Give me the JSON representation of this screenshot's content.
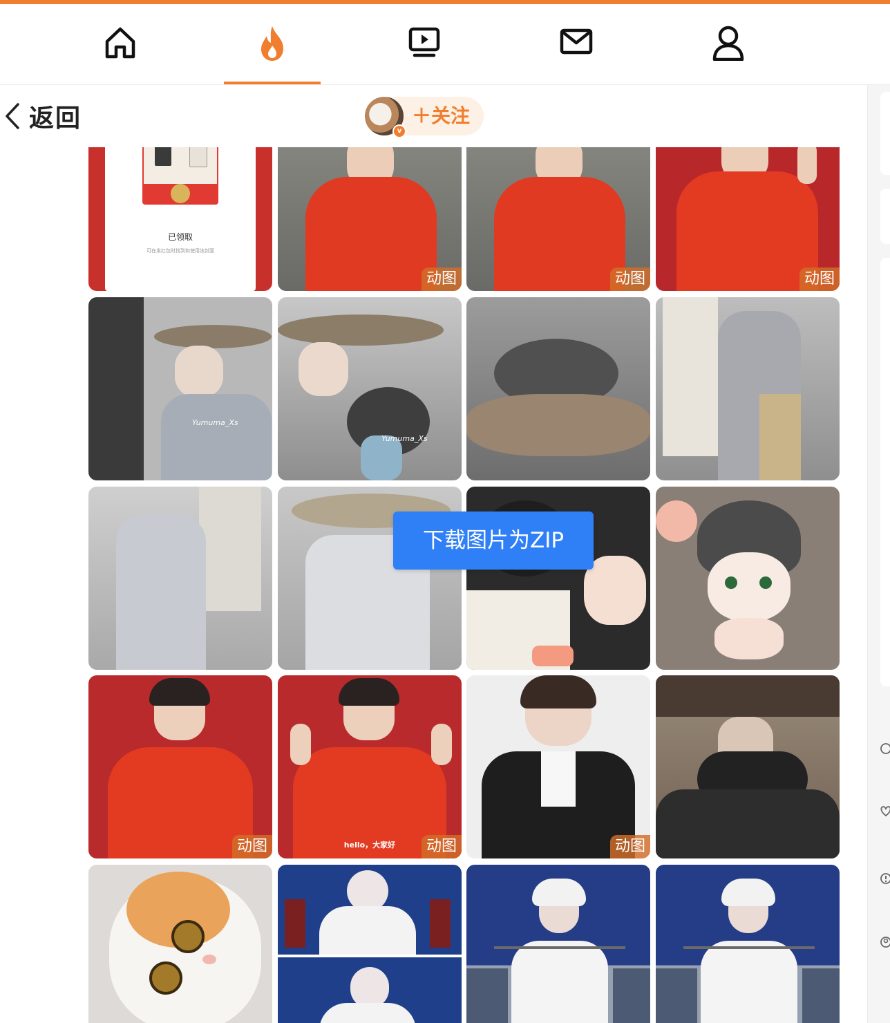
{
  "topnav": {
    "items": [
      {
        "icon": "home-icon",
        "active": false
      },
      {
        "icon": "fire-icon",
        "active": true
      },
      {
        "icon": "video-icon",
        "active": false
      },
      {
        "icon": "mail-icon",
        "active": false
      },
      {
        "icon": "user-icon",
        "active": false
      }
    ],
    "accent_color": "#f07e2e"
  },
  "header": {
    "back_label": "返回",
    "follow_label": "＋关注",
    "verified_badge": "v"
  },
  "gallery": {
    "gif_badge": "动图",
    "tiles": [
      {
        "id": "r0c0",
        "type": "red-envelope",
        "texts": [
          "已领取",
          "可在发红包时找到和使用该封面"
        ]
      },
      {
        "id": "r0c1",
        "type": "red-hoodie",
        "gif": true
      },
      {
        "id": "r0c2",
        "type": "red-hoodie",
        "gif": true
      },
      {
        "id": "r0c3",
        "type": "red-hoodie-wave",
        "gif": true
      },
      {
        "id": "r1c0",
        "type": "straw-hat",
        "watermark": "Yumuma_Xs"
      },
      {
        "id": "r1c1",
        "type": "straw-hat-crew",
        "watermark": "Yumuma_Xs"
      },
      {
        "id": "r1c2",
        "type": "straw-hat-closeup"
      },
      {
        "id": "r1c3",
        "type": "banner-scene"
      },
      {
        "id": "r2c0",
        "type": "banner-scene-pale"
      },
      {
        "id": "r2c1",
        "type": "straw-hat-pale"
      },
      {
        "id": "r2c2",
        "type": "plush-toys"
      },
      {
        "id": "r2c3",
        "type": "plush-doll"
      },
      {
        "id": "r3c0",
        "type": "red-hoodie-portrait",
        "gif": true
      },
      {
        "id": "r3c1",
        "type": "red-hoodie-wave",
        "gif": true,
        "caption": "hello，大家好"
      },
      {
        "id": "r3c2",
        "type": "leather-jacket",
        "gif": true
      },
      {
        "id": "r3c3",
        "type": "on-set-crew"
      },
      {
        "id": "r4c0",
        "type": "cat"
      },
      {
        "id": "r4c1",
        "type": "white-robe-split"
      },
      {
        "id": "r4c2",
        "type": "white-robe-sword"
      },
      {
        "id": "r4c3",
        "type": "white-robe-sword"
      }
    ]
  },
  "zip_button": {
    "label": "下载图片为ZIP",
    "color": "#2f7ff6"
  }
}
